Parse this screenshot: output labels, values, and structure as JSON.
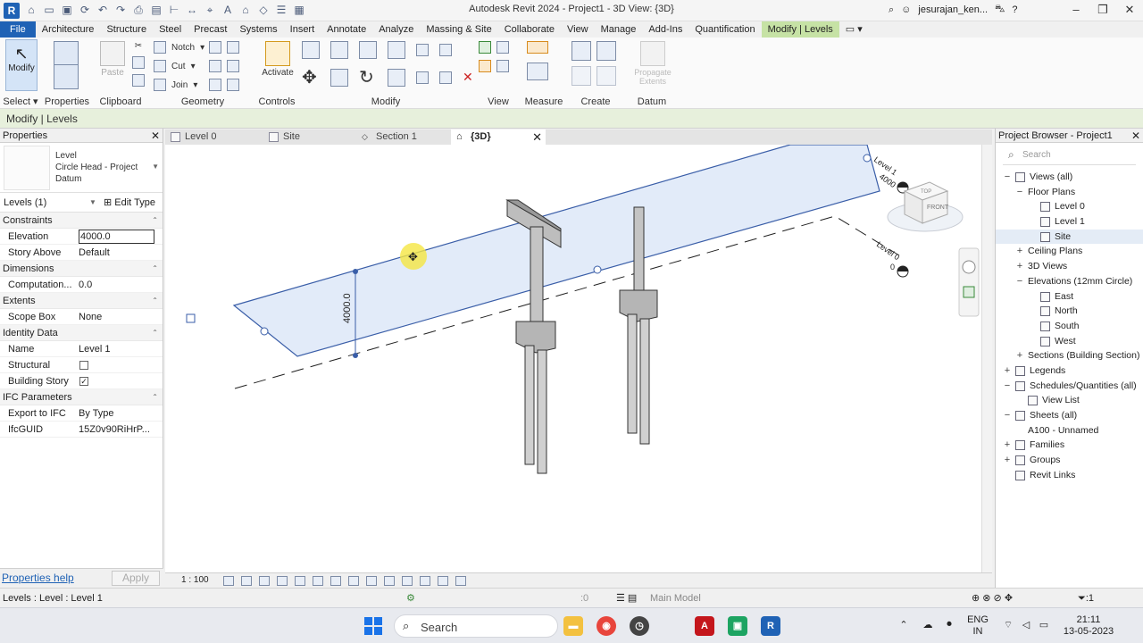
{
  "app": {
    "title": "Autodesk Revit 2024 - Project1 - 3D View: {3D}",
    "logo_letter": "R",
    "user": "jesurajan_ken...",
    "help": "?"
  },
  "menu": {
    "file": "File",
    "tabs": [
      "Architecture",
      "Structure",
      "Steel",
      "Precast",
      "Systems",
      "Insert",
      "Annotate",
      "Analyze",
      "Massing & Site",
      "Collaborate",
      "View",
      "Manage",
      "Add-Ins",
      "Quantification"
    ],
    "active_tab": "Modify | Levels"
  },
  "ribbon": {
    "select_label": "Select",
    "modify_label": "Modify",
    "properties_label": "Properties",
    "clipboard_label": "Clipboard",
    "geometry_label": "Geometry",
    "controls_label": "Controls",
    "modify_group_label": "Modify",
    "view_label": "View",
    "measure_label": "Measure",
    "create_label": "Create",
    "datum_label": "Datum",
    "notch": "Notch",
    "cut": "Cut",
    "join": "Join",
    "activate": "Activate",
    "paste": "Paste",
    "propagate_extents": "Propagate Extents"
  },
  "context_title": "Modify | Levels",
  "properties": {
    "panel_title": "Properties",
    "type_lines": [
      "Level",
      "Circle Head - Project",
      "Datum"
    ],
    "instance_filter": "Levels (1)",
    "edit_type": "Edit Type",
    "sections": [
      {
        "name": "Constraints",
        "rows": [
          {
            "name": "Elevation",
            "value": "4000.0",
            "input": true
          },
          {
            "name": "Story Above",
            "value": "Default"
          }
        ]
      },
      {
        "name": "Dimensions",
        "rows": [
          {
            "name": "Computation...",
            "value": "0.0"
          }
        ]
      },
      {
        "name": "Extents",
        "rows": [
          {
            "name": "Scope Box",
            "value": "None"
          }
        ]
      },
      {
        "name": "Identity Data",
        "rows": [
          {
            "name": "Name",
            "value": "Level 1"
          },
          {
            "name": "Structural",
            "value": "",
            "check": false
          },
          {
            "name": "Building Story",
            "value": "",
            "check": true
          }
        ]
      },
      {
        "name": "IFC Parameters",
        "rows": [
          {
            "name": "Export to IFC",
            "value": "By Type"
          },
          {
            "name": "IfcGUID",
            "value": "15Z0v90RiHrP..."
          }
        ]
      }
    ],
    "help_link": "Properties help",
    "apply": "Apply"
  },
  "view_tabs": [
    {
      "label": "Level 0"
    },
    {
      "label": "Site"
    },
    {
      "label": "Section 1"
    },
    {
      "label": "{3D}",
      "active": true
    }
  ],
  "canvas": {
    "dimension_text": "4000.0",
    "level1_tag": "Level 1",
    "level1_value": "4000",
    "level0_tag": "Level 0",
    "level0_value": "0",
    "viewcube_face": "FRONT",
    "viewcube_top": "TOP"
  },
  "view_control": {
    "scale": "1 : 100"
  },
  "browser": {
    "title": "Project Browser - Project1",
    "search_placeholder": "Search",
    "items": [
      {
        "label": "Views (all)",
        "level": 0,
        "exp": "−",
        "icon": true
      },
      {
        "label": "Floor Plans",
        "level": 1,
        "exp": "−"
      },
      {
        "label": "Level 0",
        "level": 2,
        "icon": true
      },
      {
        "label": "Level 1",
        "level": 2,
        "icon": true
      },
      {
        "label": "Site",
        "level": 2,
        "icon": true,
        "selected": true
      },
      {
        "label": "Ceiling Plans",
        "level": 1,
        "exp": "+"
      },
      {
        "label": "3D Views",
        "level": 1,
        "exp": "+"
      },
      {
        "label": "Elevations (12mm Circle)",
        "level": 1,
        "exp": "−"
      },
      {
        "label": "East",
        "level": 2,
        "icon": true
      },
      {
        "label": "North",
        "level": 2,
        "icon": true
      },
      {
        "label": "South",
        "level": 2,
        "icon": true
      },
      {
        "label": "West",
        "level": 2,
        "icon": true
      },
      {
        "label": "Sections (Building Section)",
        "level": 1,
        "exp": "+"
      },
      {
        "label": "Legends",
        "level": 0,
        "exp": "+",
        "icon": true
      },
      {
        "label": "Schedules/Quantities (all)",
        "level": 0,
        "exp": "−",
        "icon": true
      },
      {
        "label": "View List",
        "level": 1,
        "icon": true
      },
      {
        "label": "Sheets (all)",
        "level": 0,
        "exp": "−",
        "icon": true
      },
      {
        "label": "A100 - Unnamed",
        "level": 1
      },
      {
        "label": "Families",
        "level": 0,
        "exp": "+",
        "icon": true
      },
      {
        "label": "Groups",
        "level": 0,
        "exp": "+",
        "icon": true
      },
      {
        "label": "Revit Links",
        "level": 0,
        "icon": true
      }
    ]
  },
  "status": {
    "text": "Levels : Level : Level 1",
    "model": "Main Model",
    "filter_count": ":1",
    "zero": ":0"
  },
  "taskbar": {
    "search": "Search",
    "lang1": "ENG",
    "lang2": "IN",
    "time": "21:11",
    "date": "13-05-2023"
  }
}
